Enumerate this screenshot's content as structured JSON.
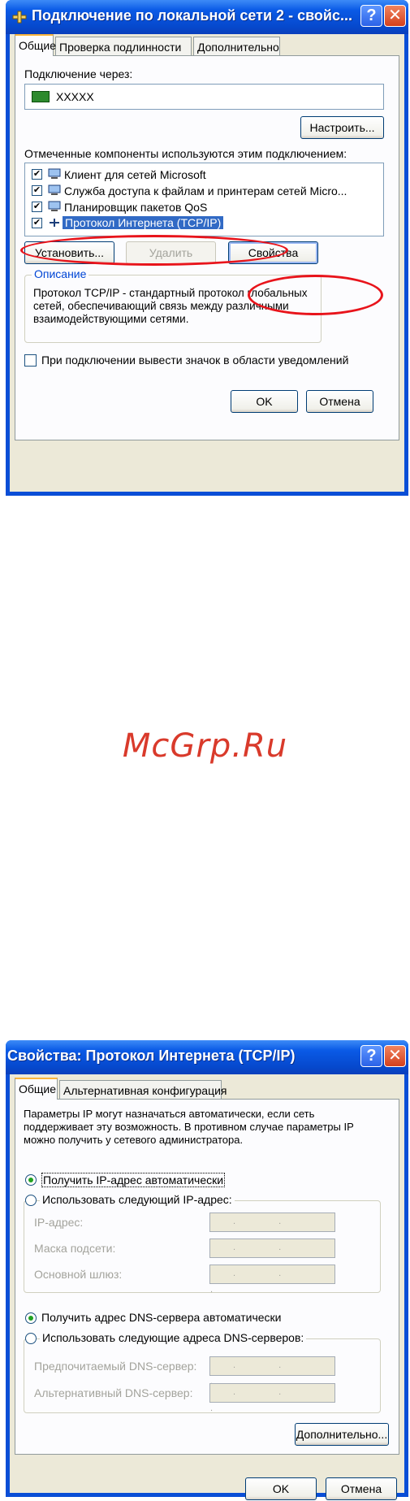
{
  "dialog1": {
    "title": "Подключение по локальной сети 2 - свойс...",
    "tabs": [
      "Общие",
      "Проверка подлинности",
      "Дополнительно"
    ],
    "connect_via_label": "Подключение через:",
    "adapter_name": "XXXXX",
    "configure_button": "Настроить...",
    "components_label": "Отмеченные компоненты используются этим подключением:",
    "components": [
      {
        "label": "Клиент для сетей Microsoft",
        "checked": true,
        "icon": "network-client-icon"
      },
      {
        "label": "Служба доступа к файлам и принтерам сетей Micro...",
        "checked": true,
        "icon": "file-printer-sharing-icon"
      },
      {
        "label": "Планировщик пакетов QoS",
        "checked": true,
        "icon": "qos-scheduler-icon"
      },
      {
        "label": "Протокол Интернета (TCP/IP)",
        "checked": true,
        "selected": true,
        "icon": "protocol-icon"
      }
    ],
    "install_button": "Установить...",
    "uninstall_button": "Удалить",
    "properties_button": "Свойства",
    "description_legend": "Описание",
    "description_text": "Протокол TCP/IP - стандартный протокол глобальных сетей, обеспечивающий связь между различными взаимодействующими сетями.",
    "show_icon_label": "При подключении вывести значок в области уведомлений",
    "ok_button": "OK",
    "cancel_button": "Отмена"
  },
  "watermark": "McGrp.Ru",
  "dialog2": {
    "title": "Свойства: Протокол Интернета (TCP/IP)",
    "tabs": [
      "Общие",
      "Альтернативная конфигурация"
    ],
    "intro_text": "Параметры IP могут назначаться автоматически, если сеть поддерживает эту возможность. В противном случае параметры IP можно получить у сетевого администратора.",
    "radio_auto_ip": "Получить IP-адрес автоматически",
    "radio_manual_ip": "Использовать следующий IP-адрес:",
    "ip_label": "IP-адрес:",
    "mask_label": "Маска подсети:",
    "gateway_label": "Основной шлюз:",
    "radio_auto_dns": "Получить адрес DNS-сервера автоматически",
    "radio_manual_dns": "Использовать следующие адреса DNS-серверов:",
    "preferred_dns_label": "Предпочитаемый DNS-сервер:",
    "alternate_dns_label": "Альтернативный DNS-сервер:",
    "ip_placeholder": ". . .",
    "advanced_button": "Дополнительно...",
    "ok_button": "OK",
    "cancel_button": "Отмена"
  },
  "colors": {
    "highlight": "#e8141b",
    "titlebar": "#0a4ed6",
    "selection": "#316ac5"
  }
}
